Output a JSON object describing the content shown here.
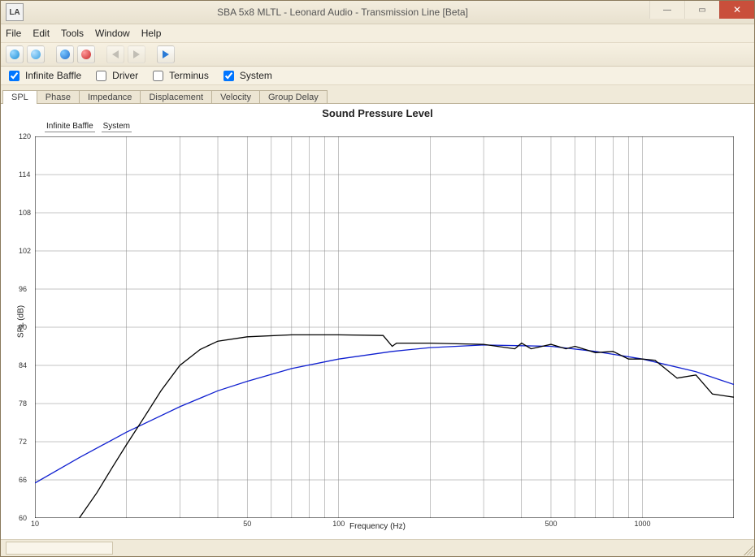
{
  "window": {
    "title": "SBA 5x8 MLTL - Leonard Audio - Transmission Line [Beta]",
    "app_icon_label": "LA"
  },
  "menubar": [
    "File",
    "Edit",
    "Tools",
    "Window",
    "Help"
  ],
  "toolbar_icons": [
    "new",
    "open",
    "record-group-blue",
    "record-red",
    "step-back",
    "step-forward",
    "play"
  ],
  "checks": [
    {
      "label": "Infinite Baffle",
      "checked": true
    },
    {
      "label": "Driver",
      "checked": false
    },
    {
      "label": "Terminus",
      "checked": false
    },
    {
      "label": "System",
      "checked": true
    }
  ],
  "tabs": [
    "SPL",
    "Phase",
    "Impedance",
    "Displacement",
    "Velocity",
    "Group Delay"
  ],
  "active_tab": "SPL",
  "chart_data": {
    "type": "line",
    "title": "Sound Pressure Level",
    "xlabel": "Frequency (Hz)",
    "ylabel": "SPL (dB)",
    "xscale": "log",
    "xlim": [
      10,
      2000
    ],
    "x_ticks": [
      10,
      50,
      100,
      500,
      1000
    ],
    "ylim": [
      60,
      120
    ],
    "y_ticks": [
      60,
      66,
      72,
      78,
      84,
      90,
      96,
      102,
      108,
      114,
      120
    ],
    "legend_items": [
      "Infinite Baffle",
      "System"
    ],
    "series": [
      {
        "name": "Infinite Baffle",
        "color": "#1020d0",
        "x": [
          10,
          14,
          20,
          30,
          40,
          50,
          70,
          100,
          150,
          200,
          300,
          500,
          700,
          1000,
          1500,
          2000
        ],
        "y": [
          65.5,
          69.5,
          73.5,
          77.5,
          80.0,
          81.5,
          83.5,
          85.0,
          86.2,
          86.8,
          87.2,
          87.0,
          86.2,
          85.0,
          83.0,
          81.0
        ]
      },
      {
        "name": "System",
        "color": "#000000",
        "x": [
          14,
          16,
          18,
          20,
          23,
          26,
          30,
          35,
          40,
          50,
          70,
          100,
          140,
          150,
          155,
          200,
          300,
          380,
          400,
          430,
          500,
          560,
          600,
          700,
          800,
          900,
          1000,
          1100,
          1300,
          1500,
          1700,
          2000
        ],
        "y": [
          60.0,
          64.0,
          68.0,
          71.5,
          76.0,
          80.0,
          84.0,
          86.5,
          87.8,
          88.5,
          88.8,
          88.8,
          88.7,
          87.0,
          87.5,
          87.5,
          87.3,
          86.6,
          87.5,
          86.6,
          87.3,
          86.6,
          87.0,
          86.0,
          86.2,
          85.0,
          85.0,
          84.8,
          82.0,
          82.5,
          79.5,
          79.0
        ]
      }
    ]
  }
}
